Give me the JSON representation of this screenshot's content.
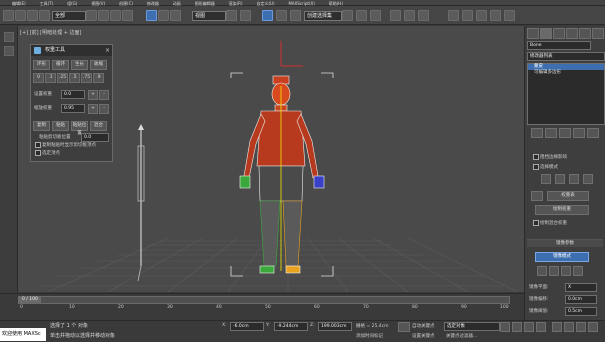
{
  "menubar": {
    "items": [
      "编辑(E)",
      "工具(T)",
      "组(G)",
      "视图(V)",
      "创建(C)",
      "修改器",
      "动画",
      "图形编辑器",
      "渲染(R)",
      "自定义(U)",
      "MAXScript(X)",
      "帮助(H)"
    ]
  },
  "toolbar": {
    "selection_filter": "全部",
    "coord_system": "视图",
    "named_sel_placeholder": "创建选择集"
  },
  "viewport": {
    "label": "[+] [前] [明暗处理 + 边面]"
  },
  "skin_wrap_panel": {
    "title": "权重工具",
    "row1": [
      "环形",
      "循环",
      "生长",
      "收缩"
    ],
    "set_weight_label": "设置权重",
    "set_weight_value": "0.0",
    "scale_weight_label": "缩放权重",
    "scale_weight_value": "0.95",
    "row3": [
      "复制",
      "粘贴",
      "粘贴位置",
      "混合"
    ],
    "copy_buffer_label": "粘贴剪切板位置",
    "copy_buffer_value": "0.0",
    "checkbox1": "复制粘贴时显示剪切板顶点",
    "checkbox2": "选定顶点"
  },
  "command_panel": {
    "object_name": "Bone",
    "modifier_list_label": "修改器列表",
    "stack": [
      "蒙皮",
      "可编辑多边形"
    ],
    "checkbox_a": "阻挡边缘影响",
    "checkbox_b": "选择模式",
    "weight_table_btn": "权重表",
    "paint_weight_btn": "绘制权重",
    "paint_blend_label": "绘制混合权重",
    "mirror_section": "镜像参数",
    "mirror_mode_btn": "镜像模式",
    "mirror_plane_label": "镜像平面:",
    "mirror_plane_value": "X",
    "mirror_offset_label": "镜像偏移:",
    "mirror_offset_value": "0.0cm",
    "mirror_threshold_label": "镜像阈值:",
    "mirror_threshold_value": "0.5cm"
  },
  "timeline": {
    "frame": "0 / 100",
    "ticks": [
      "0",
      "10",
      "20",
      "30",
      "40",
      "50",
      "60",
      "70",
      "80",
      "90",
      "100"
    ]
  },
  "status": {
    "selected_text": "选择了 1 个 对象",
    "prompt_text": "单击并拖动以选择并移动对象",
    "x_label": "X:",
    "x_value": "-6.0cm",
    "y_label": "Y:",
    "y_value": "-9.244cm",
    "z_label": "Z:",
    "z_value": "199.003cm",
    "grid_label": "栅格 = 25.4cm",
    "autokey": "自动关键点",
    "selected_obj": "选定对象",
    "setkey": "设置关键点",
    "keyfilter": "关键点过滤器...",
    "add_tag": "添加时间标记",
    "welcome": "欢迎使用 MAXSc"
  }
}
